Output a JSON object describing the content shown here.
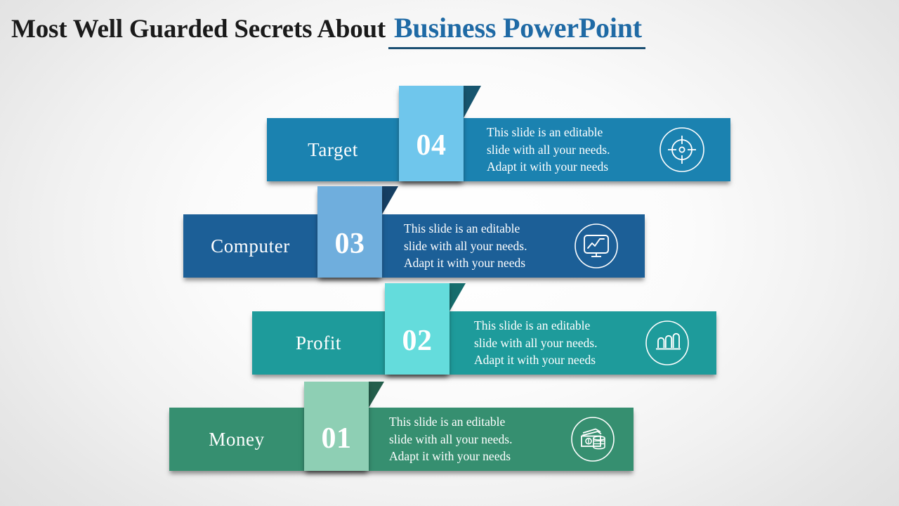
{
  "slide": {
    "title_main": "Most Well Guarded Secrets About",
    "title_accent": "Business PowerPoint",
    "accent_color": "#1F6AA5",
    "underline_color": "#1b4f72"
  },
  "rows": [
    {
      "number": "04",
      "label": "Target",
      "icon": "target-icon",
      "bar_color": "#1B82B0",
      "tab_color": "#6FC6EC",
      "fold_color": "#17556F",
      "desc_line1": "This slide is an editable",
      "desc_line2": "slide with all your needs.",
      "desc_line3": "Adapt it with your needs"
    },
    {
      "number": "03",
      "label": "Computer",
      "icon": "monitor-chart-icon",
      "bar_color": "#1C5F97",
      "tab_color": "#6FAEDD",
      "fold_color": "#163F63",
      "desc_line1": "This slide is an editable",
      "desc_line2": "slide with all your needs.",
      "desc_line3": "Adapt it with your needs"
    },
    {
      "number": "02",
      "label": "Profit",
      "icon": "bar-chart-icon",
      "bar_color": "#1E9B9B",
      "tab_color": "#64DCDC",
      "fold_color": "#166D6D",
      "desc_line1": "This slide is an editable",
      "desc_line2": "slide with all your needs.",
      "desc_line3": "Adapt it with your needs"
    },
    {
      "number": "01",
      "label": "Money",
      "icon": "money-cash-icon",
      "bar_color": "#368F70",
      "tab_color": "#8ECFB4",
      "fold_color": "#245E4C",
      "desc_line1": "This slide is an editable",
      "desc_line2": "slide with all your needs.",
      "desc_line3": "Adapt it with your needs"
    }
  ]
}
